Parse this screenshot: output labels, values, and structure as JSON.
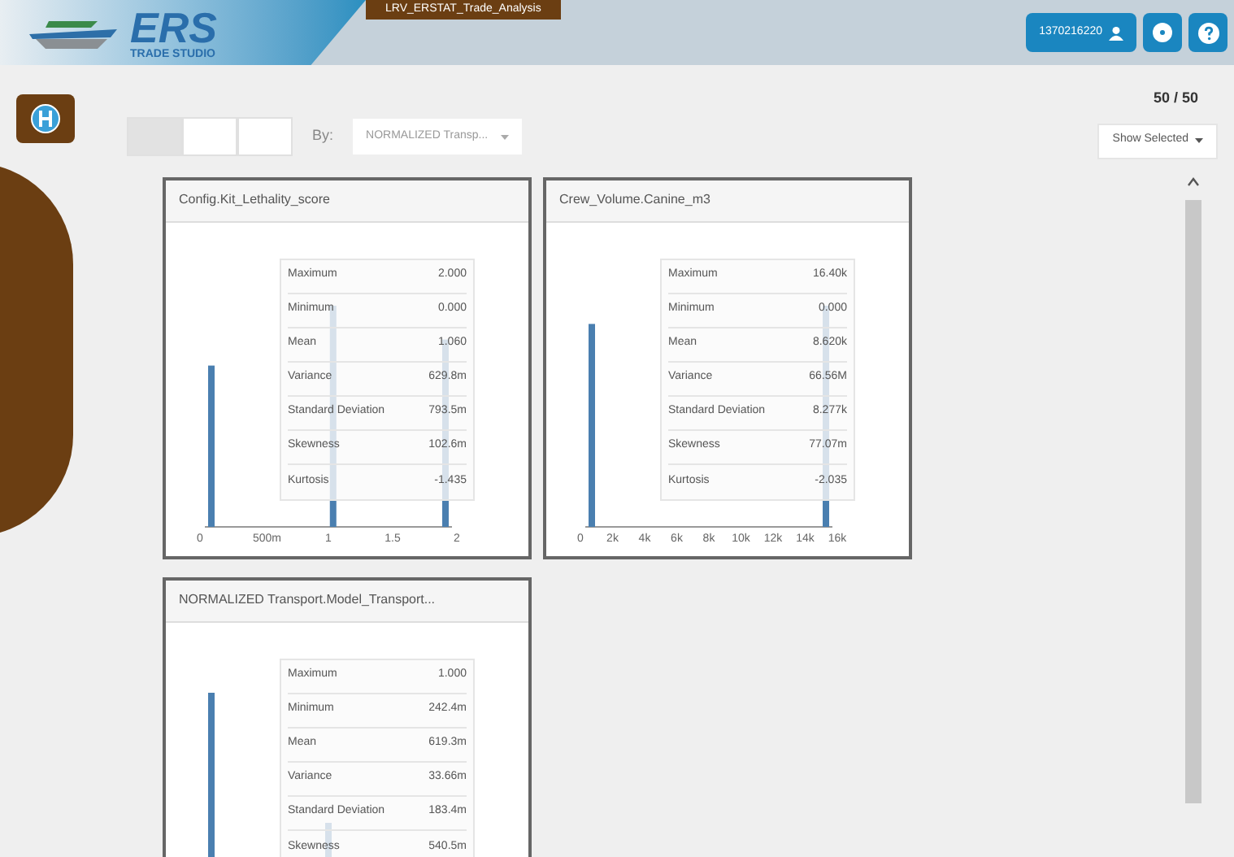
{
  "header": {
    "logo_text": "ERS",
    "logo_subtext": "TRADE STUDIO",
    "project_title": "LRV_ERSTAT_Trade_Analysis",
    "user_id": "1370216220"
  },
  "toolbar": {
    "view_toggles": [
      {
        "selected": true
      },
      {
        "selected": false
      },
      {
        "selected": false
      }
    ],
    "by_label": "By:",
    "by_value": "NORMALIZED Transp...",
    "count": "50 / 50",
    "filter_button": "Show Selected"
  },
  "cards": [
    {
      "title": "Config.Kit_Lethality_score",
      "x_ticks": [
        "0",
        "500m",
        "1",
        "1.5",
        "2"
      ],
      "stats": [
        {
          "label": "Maximum",
          "value": "2.000"
        },
        {
          "label": "Minimum",
          "value": "0.000"
        },
        {
          "label": "Mean",
          "value": "1.060"
        },
        {
          "label": "Variance",
          "value": "629.8m"
        },
        {
          "label": "Standard Deviation",
          "value": "793.5m"
        },
        {
          "label": "Skewness",
          "value": "102.6m"
        },
        {
          "label": "Kurtosis",
          "value": "-1.435"
        }
      ]
    },
    {
      "title": "Crew_Volume.Canine_m3",
      "x_ticks": [
        "0",
        "2k",
        "4k",
        "6k",
        "8k",
        "10k",
        "12k",
        "14k",
        "16k"
      ],
      "stats": [
        {
          "label": "Maximum",
          "value": "16.40k"
        },
        {
          "label": "Minimum",
          "value": "0.000"
        },
        {
          "label": "Mean",
          "value": "8.620k"
        },
        {
          "label": "Variance",
          "value": "66.56M"
        },
        {
          "label": "Standard Deviation",
          "value": "8.277k"
        },
        {
          "label": "Skewness",
          "value": "77.07m"
        },
        {
          "label": "Kurtosis",
          "value": "-2.035"
        }
      ]
    },
    {
      "title": "NORMALIZED Transport.Model_Transport...",
      "stats": [
        {
          "label": "Maximum",
          "value": "1.000"
        },
        {
          "label": "Minimum",
          "value": "242.4m"
        },
        {
          "label": "Mean",
          "value": "619.3m"
        },
        {
          "label": "Variance",
          "value": "33.66m"
        },
        {
          "label": "Standard Deviation",
          "value": "183.4m"
        },
        {
          "label": "Skewness",
          "value": "540.5m"
        }
      ]
    }
  ]
}
